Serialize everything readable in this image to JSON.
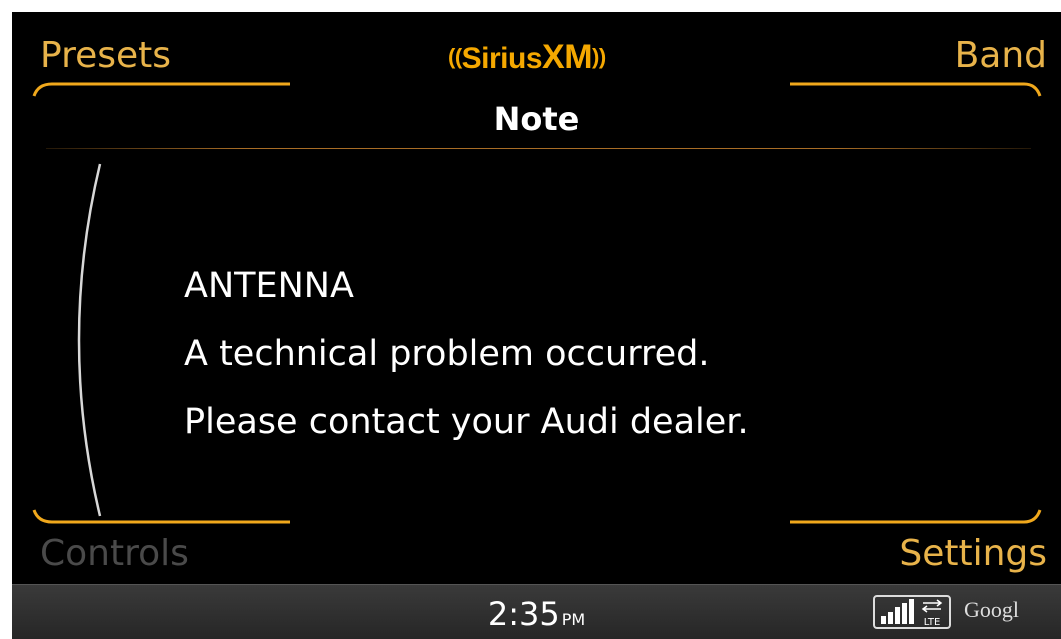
{
  "header": {
    "presets_label": "Presets",
    "band_label": "Band",
    "brand": {
      "waves_left": "((",
      "sirius": "Sirius",
      "xm": "XM",
      "waves_right": "))"
    },
    "title": "Note"
  },
  "message": {
    "line1": "ANTENNA",
    "line2": "A technical problem occurred.",
    "line3": "Please contact your Audi dealer."
  },
  "footer": {
    "controls_label": "Controls",
    "settings_label": "Settings"
  },
  "statusbar": {
    "time": "2:35",
    "ampm": "PM",
    "network": "LTE",
    "provider": "Googl"
  },
  "colors": {
    "accent": "#f0a81c",
    "brand": "#f5a800",
    "label_active": "#e8b34a",
    "label_disabled": "#4a4a4a",
    "background": "#000000"
  }
}
